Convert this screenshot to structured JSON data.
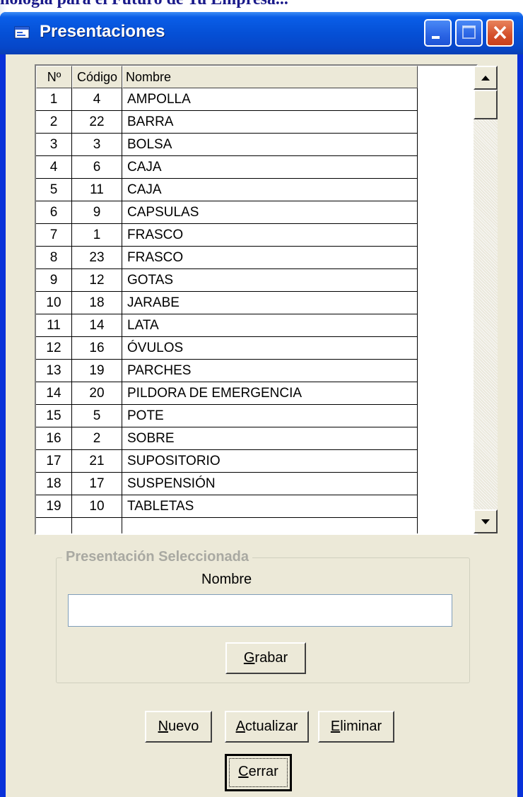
{
  "background": {
    "text": "nología para el Futuro de Tu Empresa..."
  },
  "window": {
    "title": "Presentaciones",
    "controls": [
      "minimize-icon",
      "maximize-icon",
      "close-icon"
    ]
  },
  "grid": {
    "columns": [
      "Nº",
      "Código",
      "Nombre"
    ],
    "rows": [
      [
        "1",
        "4",
        "AMPOLLA"
      ],
      [
        "2",
        "22",
        "BARRA"
      ],
      [
        "3",
        "3",
        "BOLSA"
      ],
      [
        "4",
        "6",
        "CAJA"
      ],
      [
        "5",
        "11",
        "CAJA"
      ],
      [
        "6",
        "9",
        "CAPSULAS"
      ],
      [
        "7",
        "1",
        "FRASCO"
      ],
      [
        "8",
        "23",
        "FRASCO"
      ],
      [
        "9",
        "12",
        "GOTAS"
      ],
      [
        "10",
        "18",
        "JARABE"
      ],
      [
        "11",
        "14",
        "LATA"
      ],
      [
        "12",
        "16",
        "ÓVULOS"
      ],
      [
        "13",
        "19",
        "PARCHES"
      ],
      [
        "14",
        "20",
        "PILDORA DE EMERGENCIA"
      ],
      [
        "15",
        "5",
        "POTE"
      ],
      [
        "16",
        "2",
        "SOBRE"
      ],
      [
        "17",
        "21",
        "SUPOSITORIO"
      ],
      [
        "18",
        "17",
        "SUSPENSIÓN"
      ],
      [
        "19",
        "10",
        "TABLETAS"
      ]
    ]
  },
  "selected": {
    "legend": "Presentación Seleccionada",
    "nombre_label": "Nombre",
    "nombre_value": "",
    "grabar": {
      "mnemonic": "G",
      "rest": "rabar"
    }
  },
  "actions": {
    "nuevo": {
      "mnemonic": "N",
      "rest": "uevo"
    },
    "actualizar": {
      "mnemonic": "A",
      "rest": "ctualizar"
    },
    "eliminar": {
      "mnemonic": "E",
      "rest": "liminar"
    },
    "cerrar": {
      "mnemonic": "C",
      "rest": "errar"
    }
  },
  "colors": {
    "titlebar": "#0550d6",
    "face": "#ece9d8",
    "close_button": "#d4502b"
  }
}
